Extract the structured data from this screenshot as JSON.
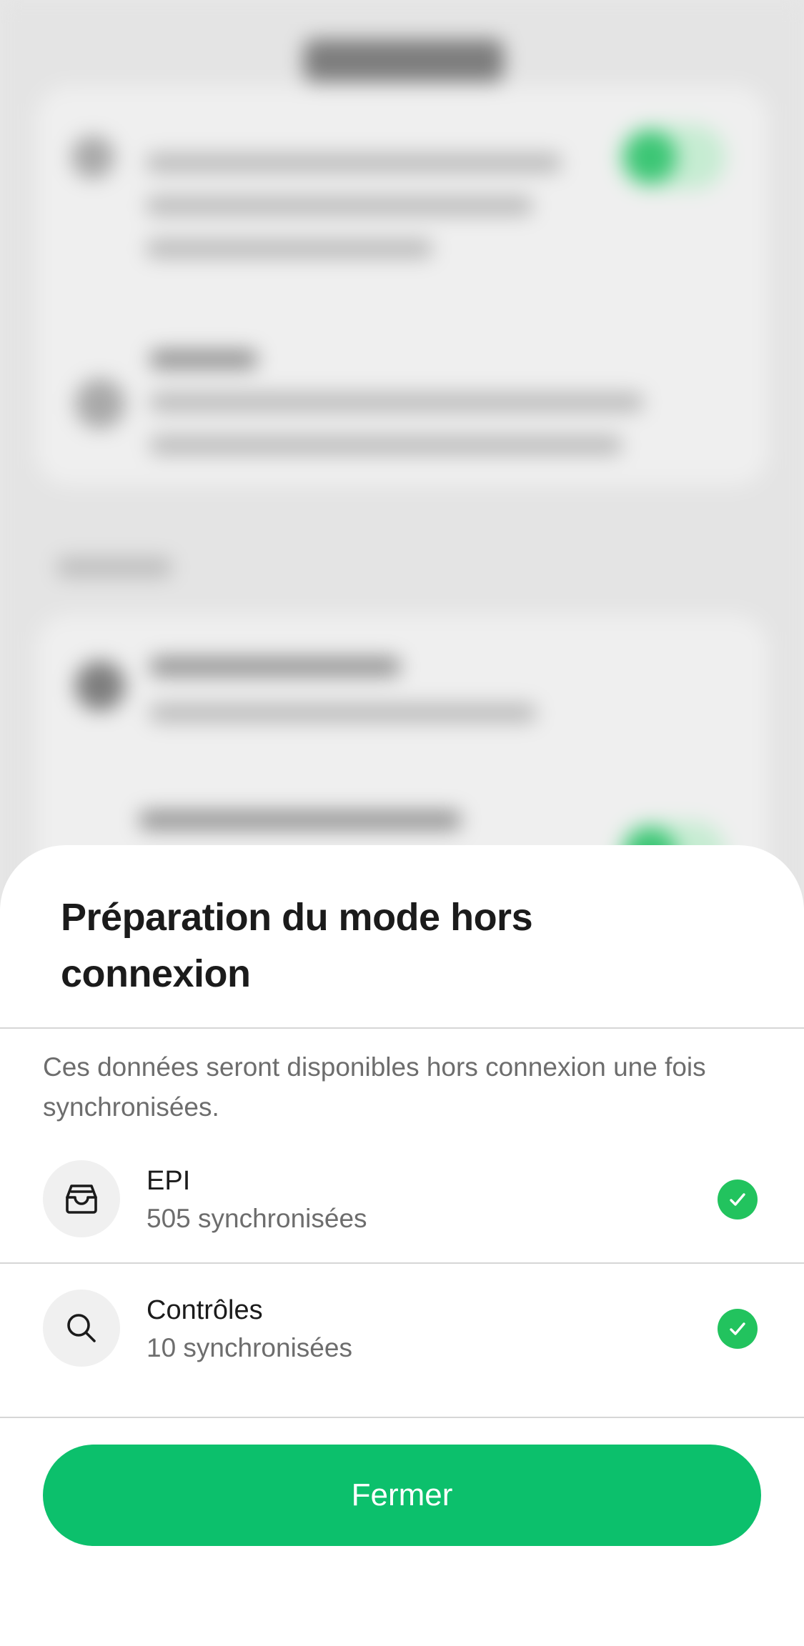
{
  "sheet": {
    "title": "Préparation du mode hors connexion",
    "description": "Ces données seront disponibles hors connexion une fois synchronisées.",
    "items": [
      {
        "icon": "inbox-tray-icon",
        "label": "EPI",
        "status": "505 synchronisées",
        "synced": true
      },
      {
        "icon": "search-icon",
        "label": "Contrôles",
        "status": "10 synchronisées",
        "synced": true
      }
    ],
    "close_label": "Fermer"
  },
  "colors": {
    "accent": "#0cc06c",
    "check": "#22c35e",
    "title_text": "#1b1b1b",
    "secondary_text": "#6d6d6d"
  }
}
